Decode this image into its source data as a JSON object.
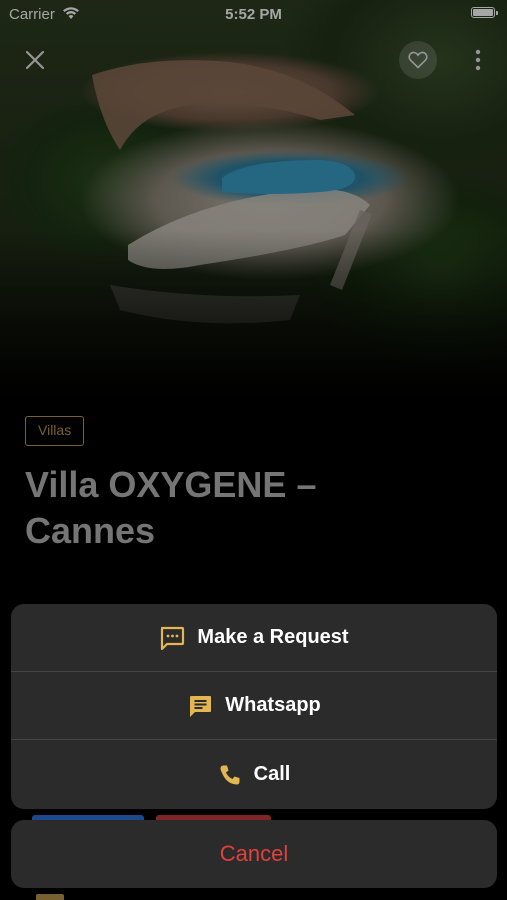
{
  "status_bar": {
    "carrier": "Carrier",
    "time": "5:52 PM"
  },
  "listing": {
    "category": "Villas",
    "title": "Villa OXYGENE – Cannes"
  },
  "action_sheet": {
    "items": [
      {
        "label": "Make a Request",
        "icon": "message-dots-icon"
      },
      {
        "label": "Whatsapp",
        "icon": "chat-bubble-icon"
      },
      {
        "label": "Call",
        "icon": "phone-icon"
      }
    ],
    "cancel_label": "Cancel"
  },
  "colors": {
    "accent_gold": "#e2b650",
    "cancel_red": "#e0413a",
    "sheet_bg": "#2b2b2b"
  }
}
